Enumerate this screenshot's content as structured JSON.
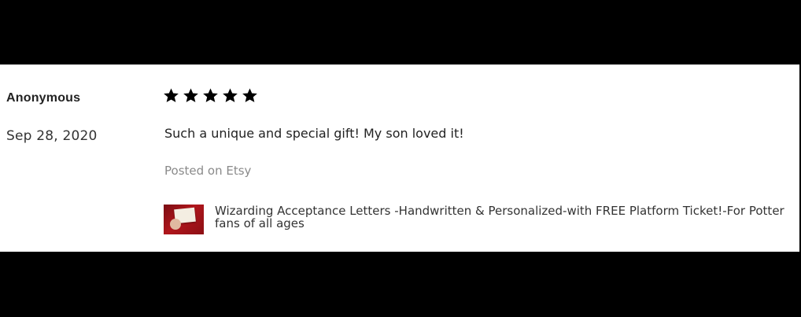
{
  "review": {
    "reviewer": "Anonymous",
    "date": "Sep 28, 2020",
    "rating": 5,
    "rating_max": 5,
    "star_color": "#000000",
    "text": "Such a unique and special gift! My son loved it!",
    "source": "Posted on Etsy",
    "listing": {
      "title": "Wizarding Acceptance Letters -Handwritten & Personalized-with FREE Platform Ticket!-For Potter fans of all ages",
      "thumbnail_colors": {
        "background": "#a0141a",
        "letter": "#f4eee2"
      }
    }
  }
}
